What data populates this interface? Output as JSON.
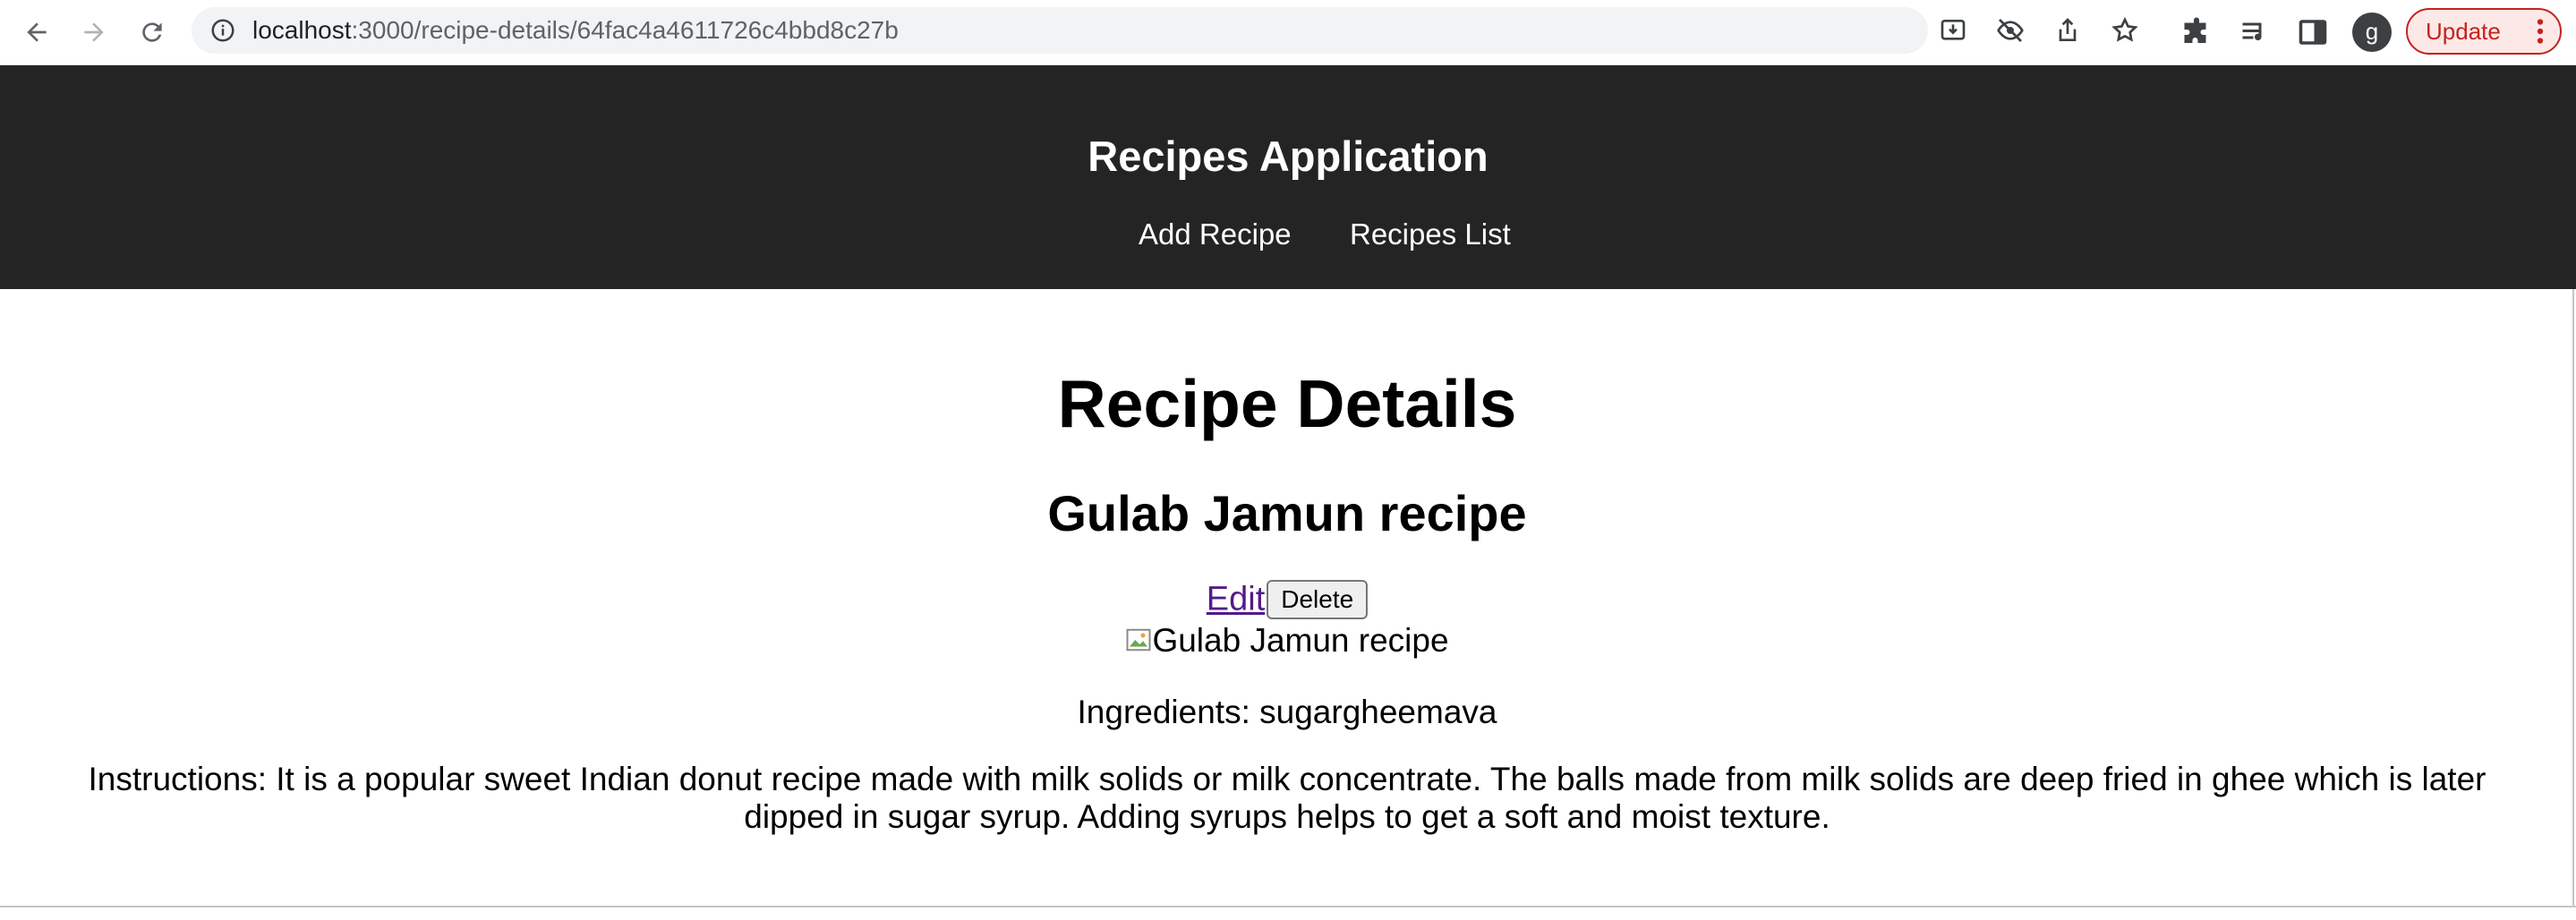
{
  "browser": {
    "url_host": "localhost",
    "url_path": ":3000/recipe-details/64fac4a4611726c4bbd8c27b",
    "profile_initial": "g",
    "update_label": "Update"
  },
  "app": {
    "title": "Recipes Application",
    "nav": [
      "Add Recipe",
      "Recipes List"
    ]
  },
  "page": {
    "heading": "Recipe Details",
    "recipe_title": "Gulab Jamun recipe",
    "edit_label": "Edit",
    "delete_label": "Delete",
    "image_alt": "Gulab Jamun recipe",
    "ingredients": "Ingredients: sugargheemava",
    "instructions": "Instructions: It is a popular sweet Indian donut recipe made with milk solids or milk concentrate. The balls made from milk solids are deep fried in ghee which is later dipped in sugar syrup. Adding syrups helps to get a soft and moist texture."
  },
  "colors": {
    "header_bg": "#242424",
    "link_visited": "#551a8b",
    "update_accent": "#c5221f"
  }
}
